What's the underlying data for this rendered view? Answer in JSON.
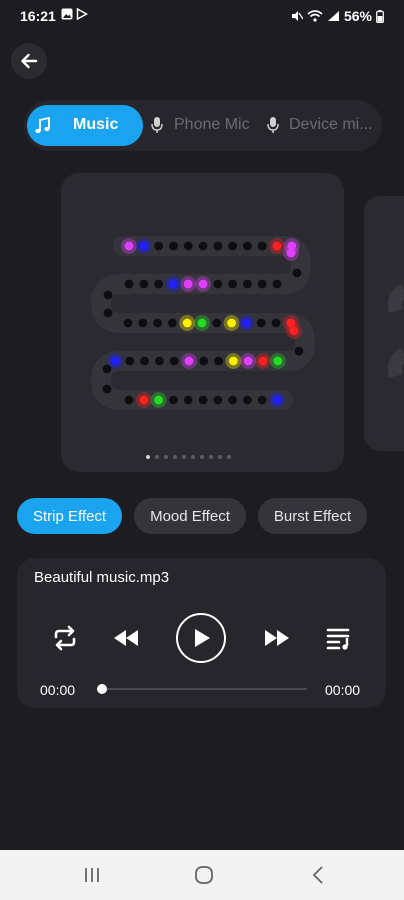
{
  "status_bar": {
    "time": "16:21",
    "battery": "56%",
    "icons": [
      "gallery-icon",
      "play-store-icon",
      "mute-icon",
      "wifi-icon",
      "signal-icon",
      "battery-icon"
    ]
  },
  "source_tabs": [
    {
      "label": "Music",
      "icon": "music-note-icon",
      "active": true
    },
    {
      "label": "Phone Mic",
      "icon": "microphone-icon",
      "active": false
    },
    {
      "label": "Device mi...",
      "icon": "microphone-icon",
      "active": false
    }
  ],
  "preview": {
    "page_count": 10,
    "active_page": 0,
    "rows": [
      [
        "#e040fb",
        "#1f1fff",
        "",
        "",
        "",
        "",
        "",
        "",
        "",
        "",
        "#ff2020",
        "#e040fb"
      ],
      [
        "",
        "",
        "",
        "",
        "",
        "#e040fb",
        "#e040fb",
        "#1f1fff",
        "",
        "",
        ""
      ],
      [
        "",
        "",
        "",
        "",
        "#ffee00",
        "#22dd22",
        "",
        "#ffee00",
        "#1f1fff",
        "",
        "",
        "#ff2020"
      ],
      [
        "#1f1fff",
        "",
        "",
        "",
        "",
        "#e040fb",
        "",
        "",
        "#ffee00",
        "#e040fb",
        "#ff2020",
        "#22dd22"
      ],
      [
        "",
        "#ff2020",
        "#22dd22",
        "",
        "",
        "",
        "",
        "",
        "",
        "",
        "#1f1fff"
      ]
    ]
  },
  "effects": [
    {
      "label": "Strip Effect",
      "active": true
    },
    {
      "label": "Mood Effect",
      "active": false
    },
    {
      "label": "Burst Effect",
      "active": false
    }
  ],
  "player": {
    "track": "Beautiful music.mp3",
    "current_time": "00:00",
    "total_time": "00:00",
    "progress": 0
  },
  "colors": {
    "accent": "#1aa3ee",
    "background": "#1c1c21",
    "card": "#26262c"
  }
}
